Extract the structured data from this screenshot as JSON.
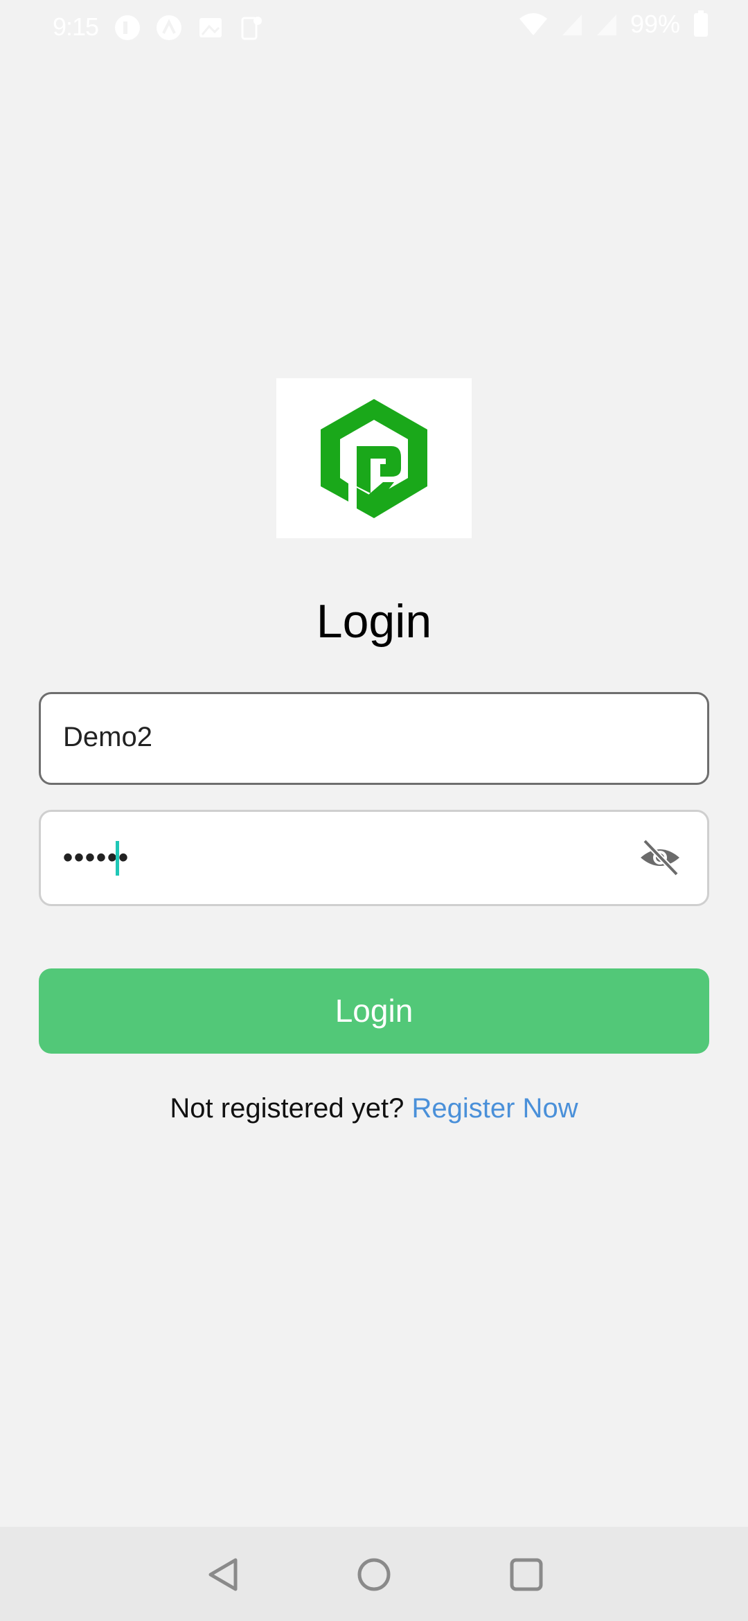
{
  "status_bar": {
    "time": "9:15",
    "battery": "99%",
    "notification_icons": [
      "app-icon",
      "app-icon",
      "image-icon",
      "phone-icon"
    ]
  },
  "logo": {
    "icon": "brand-logo-icon",
    "color": "#1aa81a"
  },
  "title": "Login",
  "username": {
    "value": "Demo2"
  },
  "password": {
    "value": "••••••",
    "toggle_icon": "eye-off-icon"
  },
  "login_button": {
    "label": "Login",
    "color": "#52c878"
  },
  "register": {
    "prompt": "Not registered yet?",
    "link": "Register Now",
    "link_color": "#4a90d9"
  },
  "nav": {
    "back": "back-icon",
    "home": "home-icon",
    "recents": "recents-icon"
  }
}
